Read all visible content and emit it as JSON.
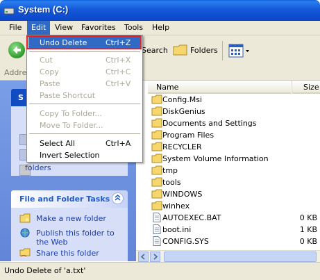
{
  "window": {
    "title": "System (C:)"
  },
  "menu": [
    {
      "label": "File"
    },
    {
      "label": "Edit"
    },
    {
      "label": "View"
    },
    {
      "label": "Favorites"
    },
    {
      "label": "Tools"
    },
    {
      "label": "Help"
    }
  ],
  "toolbar": {
    "search_label": "Search",
    "folders_label": "Folders"
  },
  "address": {
    "label": "Addres"
  },
  "edit_menu": {
    "undo": {
      "label": "Undo Delete",
      "shortcut": "Ctrl+Z"
    },
    "cut": {
      "label": "Cut",
      "shortcut": "Ctrl+X"
    },
    "copy": {
      "label": "Copy",
      "shortcut": "Ctrl+C"
    },
    "paste": {
      "label": "Paste",
      "shortcut": "Ctrl+V"
    },
    "paste_shortcut": {
      "label": "Paste Shortcut"
    },
    "copy_to_folder": {
      "label": "Copy To Folder..."
    },
    "move_to_folder": {
      "label": "Move To Folder..."
    },
    "select_all": {
      "label": "Select All",
      "shortcut": "Ctrl+A"
    },
    "invert_selection": {
      "label": "Invert Selection"
    }
  },
  "left_pane": {
    "system_tasks": {
      "visible_title": "S",
      "link_partial": "folders"
    },
    "file_folder_tasks": {
      "title": "File and Folder Tasks",
      "tasks": [
        {
          "label": "Make a new folder",
          "icon": "new-folder-icon"
        },
        {
          "label": "Publish this folder to the Web",
          "icon": "publish-web-icon"
        },
        {
          "label": "Share this folder",
          "icon": "share-folder-icon"
        }
      ]
    }
  },
  "file_list": {
    "columns": {
      "name": "Name",
      "size": "Size"
    },
    "items": [
      {
        "name": "Config.Msi",
        "size": "",
        "type": "folder"
      },
      {
        "name": "DiskGenius",
        "size": "",
        "type": "folder"
      },
      {
        "name": "Documents and Settings",
        "size": "",
        "type": "folder"
      },
      {
        "name": "Program Files",
        "size": "",
        "type": "folder"
      },
      {
        "name": "RECYCLER",
        "size": "",
        "type": "folder"
      },
      {
        "name": "System Volume Information",
        "size": "",
        "type": "folder"
      },
      {
        "name": "tmp",
        "size": "",
        "type": "folder"
      },
      {
        "name": "tools",
        "size": "",
        "type": "folder"
      },
      {
        "name": "WINDOWS",
        "size": "",
        "type": "folder"
      },
      {
        "name": "winhex",
        "size": "",
        "type": "folder"
      },
      {
        "name": "AUTOEXEC.BAT",
        "size": "0 KB",
        "type": "file"
      },
      {
        "name": "boot.ini",
        "size": "1 KB",
        "type": "file"
      },
      {
        "name": "CONFIG.SYS",
        "size": "0 KB",
        "type": "file"
      }
    ]
  },
  "status": {
    "text": "Undo Delete of 'a.txt'"
  },
  "colors": {
    "titlebar": "#0a46c8",
    "menu_highlight": "#316ac5",
    "outline": "#e0202a",
    "folder": "#f5d76e"
  }
}
